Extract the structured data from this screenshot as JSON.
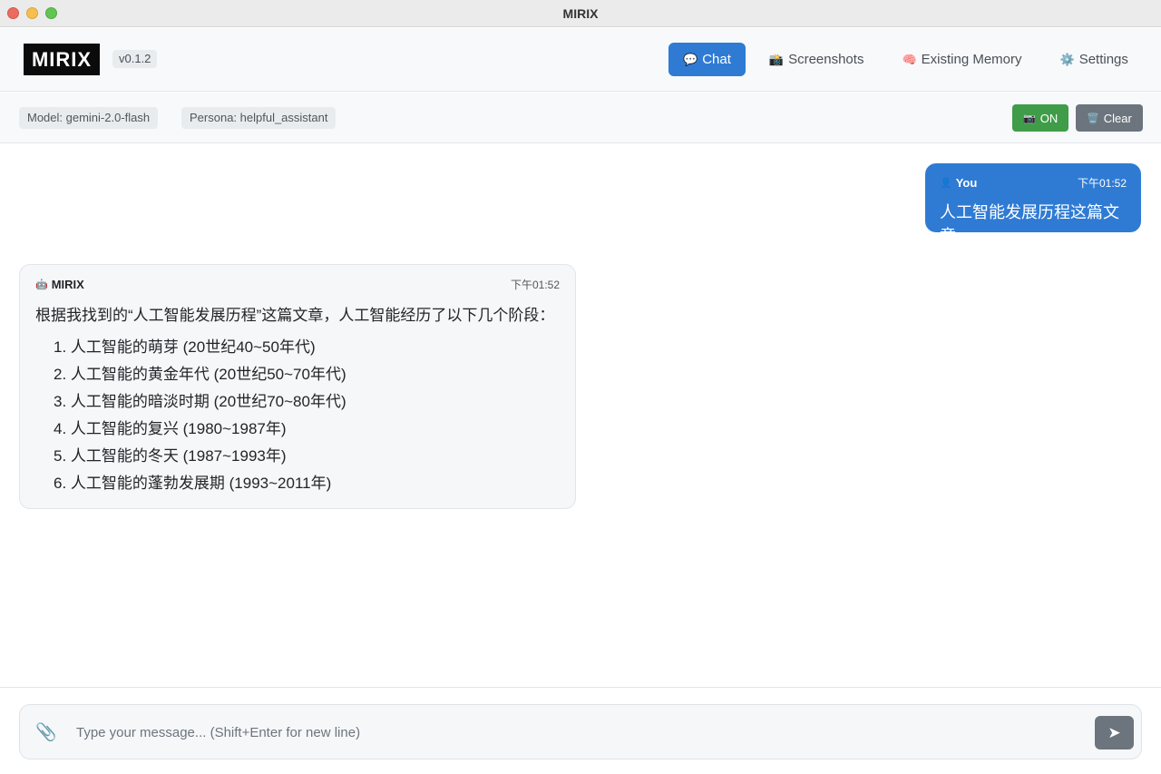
{
  "window": {
    "title": "MIRIX"
  },
  "header": {
    "logo_text": "MIRIX",
    "version": "v0.1.2",
    "tabs": [
      {
        "icon": "💬",
        "icon_name": "speech-bubble-icon",
        "label": "Chat",
        "active": true
      },
      {
        "icon": "📸",
        "icon_name": "camera-icon",
        "label": "Screenshots",
        "active": false
      },
      {
        "icon": "🧠",
        "icon_name": "brain-icon",
        "label": "Existing Memory",
        "active": false
      },
      {
        "icon": "⚙️",
        "icon_name": "gear-icon",
        "label": "Settings",
        "active": false
      }
    ]
  },
  "infobar": {
    "model": "Model: gemini-2.0-flash",
    "persona": "Persona: helpful_assistant",
    "on_button": {
      "icon": "📷",
      "icon_name": "camera-icon",
      "label": "ON"
    },
    "clear_button": {
      "icon": "🗑️",
      "icon_name": "trash-icon",
      "label": "Clear"
    }
  },
  "messages": {
    "user": {
      "icon": "👤",
      "icon_name": "user-icon",
      "sender": "You",
      "time": "下午01:52",
      "text": "人工智能发展历程这篇文章"
    },
    "assistant": {
      "icon": "🤖",
      "icon_name": "robot-icon",
      "sender": "MIRIX",
      "time": "下午01:52",
      "intro": "根据我找到的“人工智能发展历程”这篇文章，人工智能经历了以下几个阶段：",
      "items": [
        "1. 人工智能的萌芽 (20世纪40~50年代)",
        "2. 人工智能的黄金年代 (20世纪50~70年代)",
        "3. 人工智能的暗淡时期 (20世纪70~80年代)",
        "4. 人工智能的复兴 (1980~1987年)",
        "5. 人工智能的冬天 (1987~1993年)",
        "6. 人工智能的蓬勃发展期 (1993~2011年)"
      ]
    }
  },
  "composer": {
    "attach_icon": "📎",
    "attach_icon_name": "paperclip-icon",
    "placeholder": "Type your message... (Shift+Enter for new line)",
    "value": "",
    "send_icon": "➤",
    "send_icon_name": "send-icon"
  },
  "colors": {
    "accent": "#2f7bd4",
    "on_button": "#3f9c48",
    "clear_button": "#6c757d"
  }
}
